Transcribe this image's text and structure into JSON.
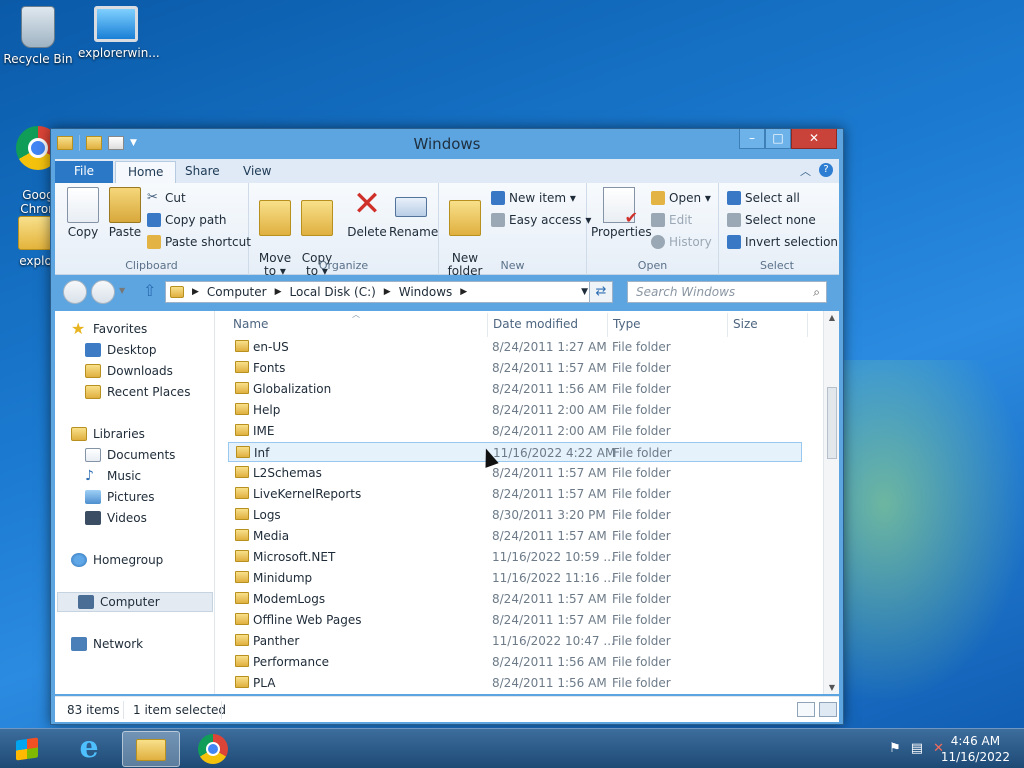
{
  "desktop": {
    "icons": [
      {
        "label": "Recycle Bin"
      },
      {
        "label": "explorerwin..."
      },
      {
        "label": "Goog\nChron"
      },
      {
        "label": "explor"
      }
    ]
  },
  "window": {
    "title": "Windows",
    "controls": {
      "minimize": "–",
      "maximize": "□",
      "close": "✕"
    }
  },
  "ribbon_tabs": {
    "file": "File",
    "home": "Home",
    "share": "Share",
    "view": "View"
  },
  "ribbon": {
    "clipboard": {
      "label": "Clipboard",
      "copy": "Copy",
      "paste": "Paste",
      "cut": "Cut",
      "copy_path": "Copy path",
      "paste_shortcut": "Paste shortcut"
    },
    "organize": {
      "label": "Organize",
      "move_to": "Move\nto ▾",
      "copy_to": "Copy\nto ▾",
      "delete": "Delete",
      "rename": "Rename"
    },
    "new": {
      "label": "New",
      "new_folder": "New\nfolder",
      "new_item": "New item ▾",
      "easy_access": "Easy access ▾"
    },
    "open": {
      "label": "Open",
      "properties": "Properties",
      "open": "Open ▾",
      "edit": "Edit",
      "history": "History"
    },
    "select": {
      "label": "Select",
      "select_all": "Select all",
      "select_none": "Select none",
      "invert_selection": "Invert selection"
    }
  },
  "address": {
    "crumbs": [
      "Computer",
      "Local Disk (C:)",
      "Windows"
    ],
    "search_placeholder": "Search Windows"
  },
  "navpane": {
    "favorites": "Favorites",
    "desktop": "Desktop",
    "downloads": "Downloads",
    "recent": "Recent Places",
    "libraries": "Libraries",
    "documents": "Documents",
    "music": "Music",
    "pictures": "Pictures",
    "videos": "Videos",
    "homegroup": "Homegroup",
    "computer": "Computer",
    "network": "Network"
  },
  "columns": {
    "name": "Name",
    "date": "Date modified",
    "type": "Type",
    "size": "Size"
  },
  "files": [
    {
      "name": "en-US",
      "date": "8/24/2011 1:27 AM",
      "type": "File folder"
    },
    {
      "name": "Fonts",
      "date": "8/24/2011 1:57 AM",
      "type": "File folder"
    },
    {
      "name": "Globalization",
      "date": "8/24/2011 1:56 AM",
      "type": "File folder"
    },
    {
      "name": "Help",
      "date": "8/24/2011 2:00 AM",
      "type": "File folder"
    },
    {
      "name": "IME",
      "date": "8/24/2011 2:00 AM",
      "type": "File folder"
    },
    {
      "name": "Inf",
      "date": "11/16/2022 4:22 AM",
      "type": "File folder",
      "selected": true
    },
    {
      "name": "L2Schemas",
      "date": "8/24/2011 1:57 AM",
      "type": "File folder"
    },
    {
      "name": "LiveKernelReports",
      "date": "8/24/2011 1:57 AM",
      "type": "File folder"
    },
    {
      "name": "Logs",
      "date": "8/30/2011 3:20 PM",
      "type": "File folder"
    },
    {
      "name": "Media",
      "date": "8/24/2011 1:57 AM",
      "type": "File folder"
    },
    {
      "name": "Microsoft.NET",
      "date": "11/16/2022 10:59 ...",
      "type": "File folder"
    },
    {
      "name": "Minidump",
      "date": "11/16/2022 11:16 ...",
      "type": "File folder"
    },
    {
      "name": "ModemLogs",
      "date": "8/24/2011 1:57 AM",
      "type": "File folder"
    },
    {
      "name": "Offline Web Pages",
      "date": "8/24/2011 1:57 AM",
      "type": "File folder"
    },
    {
      "name": "Panther",
      "date": "11/16/2022 10:47 ...",
      "type": "File folder"
    },
    {
      "name": "Performance",
      "date": "8/24/2011 1:56 AM",
      "type": "File folder"
    },
    {
      "name": "PLA",
      "date": "8/24/2011 1:56 AM",
      "type": "File folder"
    }
  ],
  "status": {
    "items": "83 items",
    "selected": "1 item selected"
  },
  "taskbar": {
    "time": "4:46 AM",
    "date": "11/16/2022"
  }
}
